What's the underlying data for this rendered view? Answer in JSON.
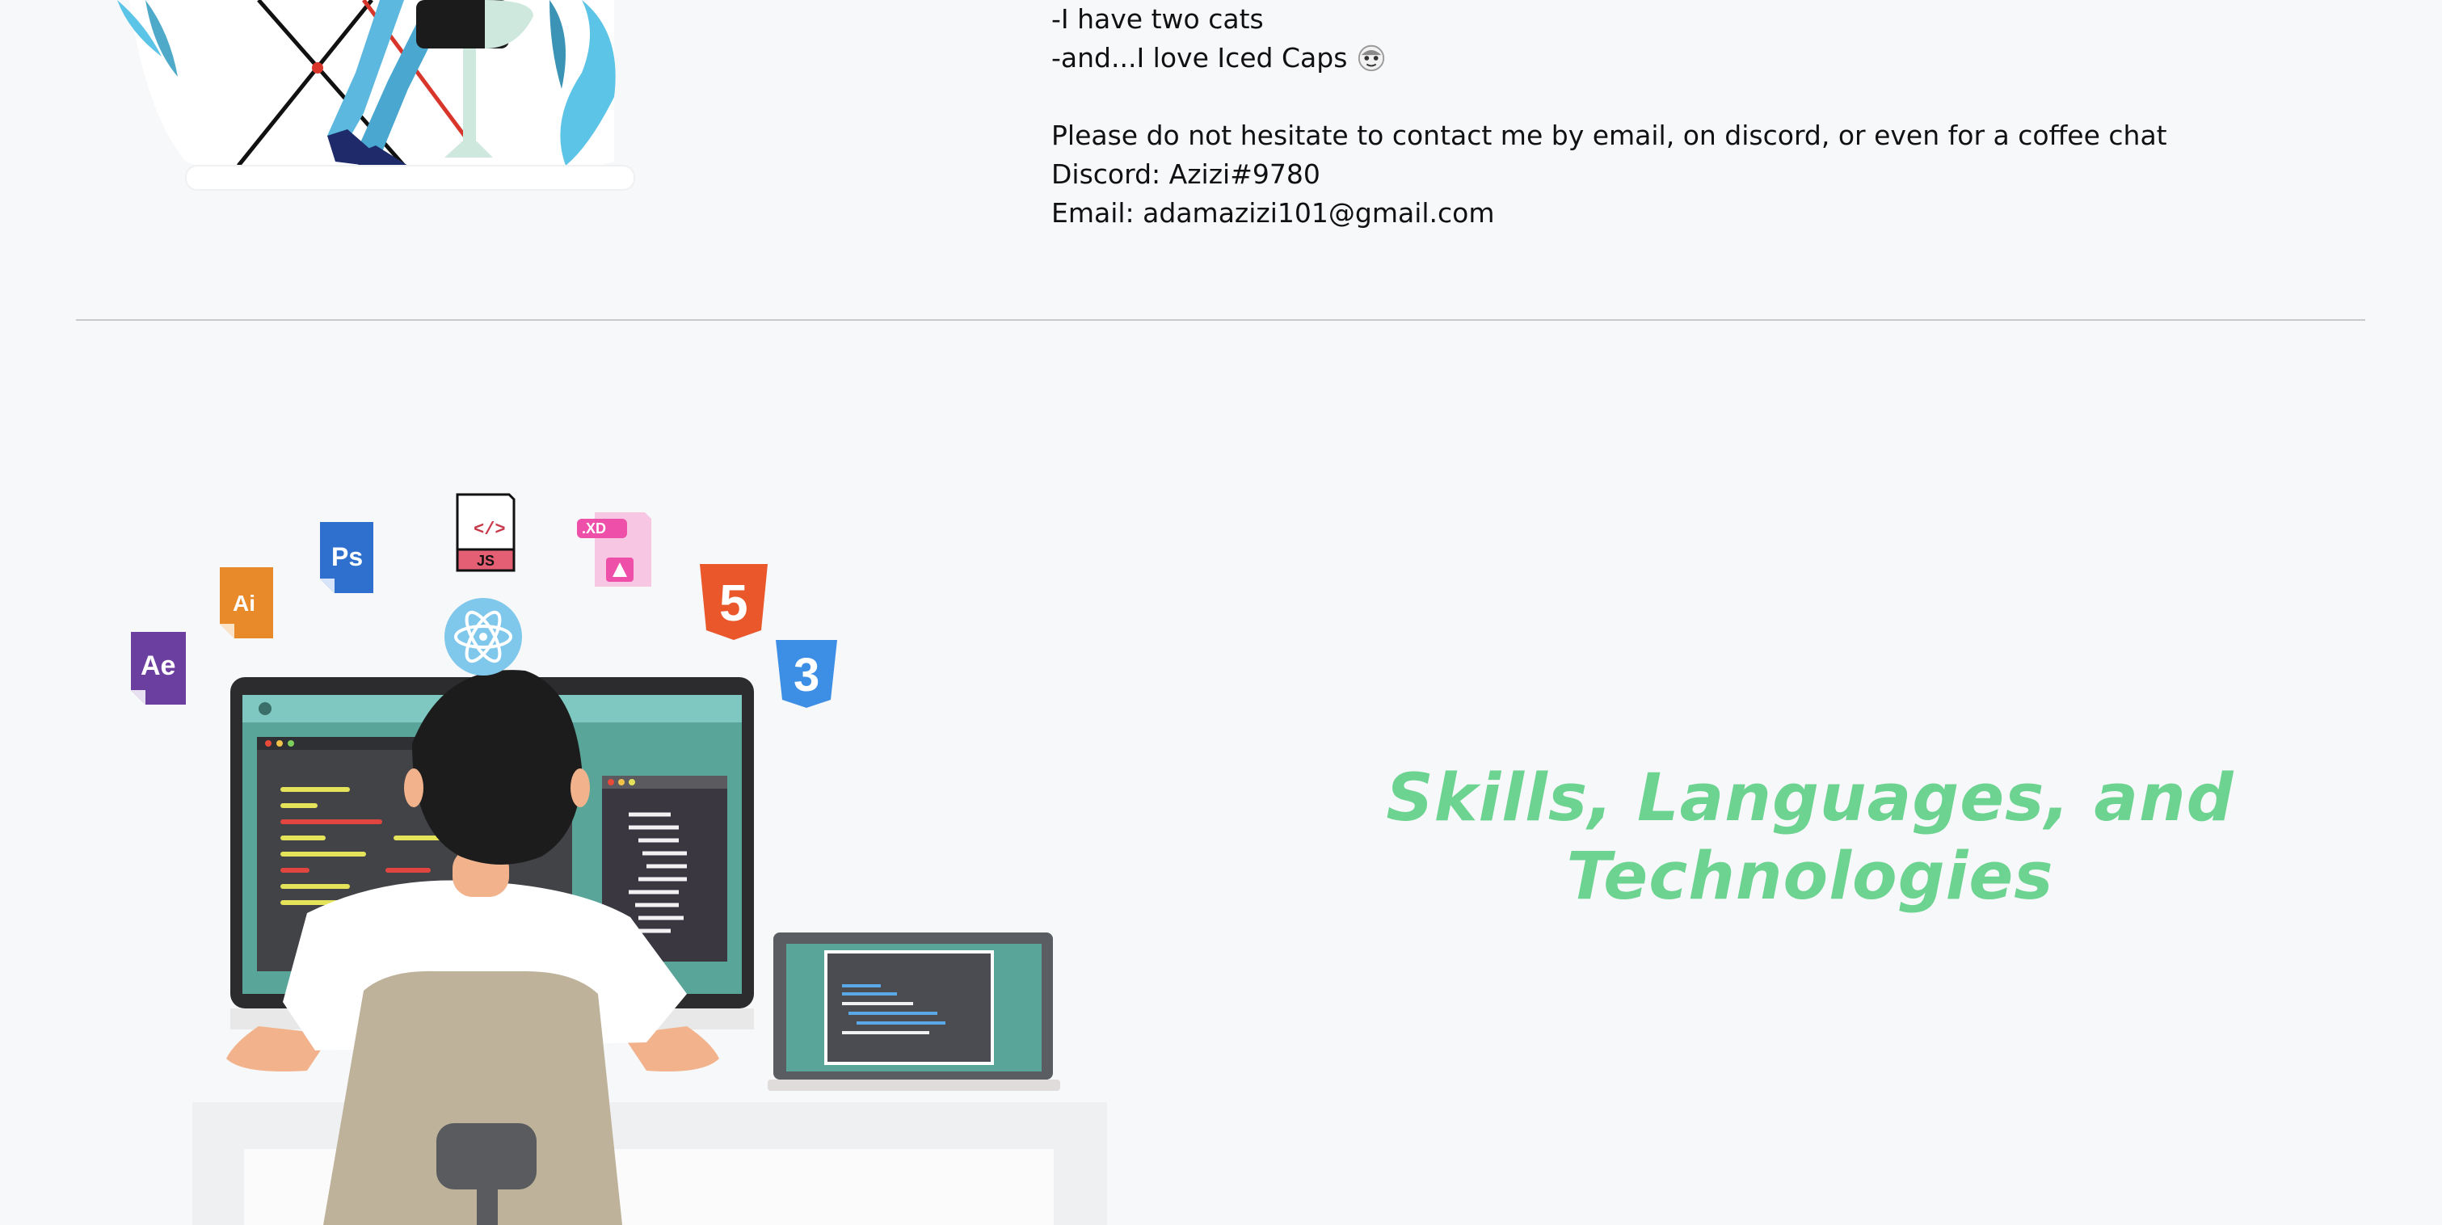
{
  "about": {
    "lines": [
      "-I have two cats",
      "-and...I love Iced Caps",
      "",
      "Please do not hesitate to contact me by email, on discord, or even for a coffee chat",
      "Discord: Azizi#9780",
      "Email: adamazizi101@gmail.com"
    ]
  },
  "skills": {
    "heading_line1": "Skills, Languages, and",
    "heading_line2": "Technologies",
    "tool_icons": [
      {
        "name": "after-effects-icon",
        "label": "Ae",
        "color": "#6b3fa0"
      },
      {
        "name": "illustrator-icon",
        "label": "Ai",
        "color": "#e88a2a"
      },
      {
        "name": "photoshop-icon",
        "label": "Ps",
        "color": "#2f6fce"
      },
      {
        "name": "javascript-file-icon",
        "label": "JS",
        "color": "#e45f73"
      },
      {
        "name": "adobe-xd-icon",
        "label": ".XD",
        "color": "#ee4fa8"
      },
      {
        "name": "html5-icon",
        "label": "5",
        "color": "#e9572b"
      },
      {
        "name": "css3-icon",
        "label": "3",
        "color": "#3d8fe6"
      },
      {
        "name": "react-icon",
        "label": "",
        "color": "#7fc8ec"
      }
    ]
  },
  "colors": {
    "background": "#f7f8fa",
    "heading": "#6cd391",
    "divider": "#c7c9cc",
    "text": "#111111"
  }
}
